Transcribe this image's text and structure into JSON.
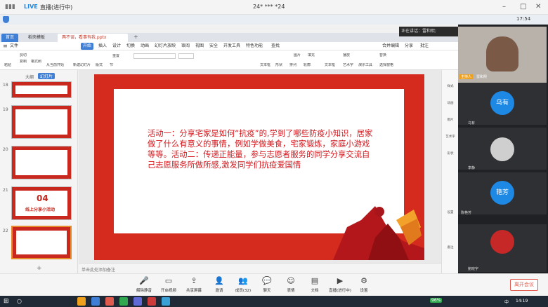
{
  "live": {
    "badge": "LIVE",
    "status": "直播(进行中)",
    "title": "24* *** *24",
    "time": "17:54"
  },
  "wps": {
    "tabs": [
      {
        "label": "首页"
      },
      {
        "label": "稻壳模板"
      },
      {
        "label": "两不误，看事有我.pptx"
      }
    ],
    "menu": [
      "文件",
      "开始",
      "插入",
      "设计",
      "切换",
      "动画",
      "幻灯片放映",
      "审阅",
      "视图",
      "安全",
      "开发工具",
      "特色功能",
      "查找"
    ],
    "menu_right": [
      "合并编辑",
      "分享",
      "批注"
    ],
    "ribbon": {
      "paste": "粘贴",
      "cut": "剪切",
      "copy": "复制",
      "format": "格式刷",
      "from_start": "从当前开始",
      "new_slide": "新建幻灯片",
      "layout": "版式",
      "section": "节",
      "reset": "重置",
      "textbox": "文本框",
      "shape": "形状",
      "arrange": "排列",
      "outline": "轮廓",
      "picture": "图片",
      "fill": "填充",
      "textbox2": "文本框",
      "art": "艺术字",
      "play": "播放",
      "media": "演示工具",
      "replace": "替换",
      "select": "选择窗格"
    },
    "pane_tabs": [
      "大纲",
      "幻灯片"
    ],
    "thumbs": [
      {
        "num": "18"
      },
      {
        "num": "19"
      },
      {
        "num": "20"
      },
      {
        "num": "21",
        "big": "04",
        "caption": "线上分享小活动"
      },
      {
        "num": "22"
      }
    ],
    "slide_text": "活动一：分享宅家是如何“抗疫”的,学到了哪些防疫小知识，居家做了什么有意义的事情，例如学做美食，宅家锻炼，家庭小游戏等等。活动二：传递正能量，参与志愿者服务的同学分享交流自己志愿服务所做所感,激发同学们抗疫爱国情",
    "notes": "单击此处添加备注",
    "right_bar": [
      "样式",
      "动画",
      "图片",
      "艺术字",
      "形状",
      "设置",
      "备注"
    ]
  },
  "meeting": {
    "speaking": "正在讲话：雷和熙;",
    "host_tag": "主持人",
    "host_name": "雷和熙",
    "participants": [
      {
        "avatar": "乌有",
        "name": "乌有",
        "color": "#1e88e5"
      },
      {
        "avatar": "",
        "name": "李静",
        "color": "#cfcfcf"
      },
      {
        "avatar": "艳芳",
        "name": "陈艳芳",
        "color": "#1e88e5"
      },
      {
        "avatar": "",
        "name": "鲍晓宇",
        "color": "#c62828"
      }
    ],
    "toolbar": [
      {
        "label": "解除静音",
        "icon": "mic"
      },
      {
        "label": "开启视频",
        "icon": "video"
      },
      {
        "label": "共享屏幕",
        "icon": "share"
      },
      {
        "label": "邀请",
        "icon": "invite"
      },
      {
        "label": "成员(32)",
        "icon": "members"
      },
      {
        "label": "聊天",
        "icon": "chat"
      },
      {
        "label": "表情",
        "icon": "emoji"
      },
      {
        "label": "文档",
        "icon": "doc"
      },
      {
        "label": "直播(进行中)",
        "icon": "live"
      },
      {
        "label": "设置",
        "icon": "settings"
      }
    ],
    "leave": "离开会议"
  },
  "taskbar": {
    "battery": "96%",
    "time": "14:19",
    "lang": "中"
  },
  "colors": {
    "slide_red": "#d42b1e",
    "slide_text": "#d4141a",
    "accent": "#1e88e5"
  }
}
